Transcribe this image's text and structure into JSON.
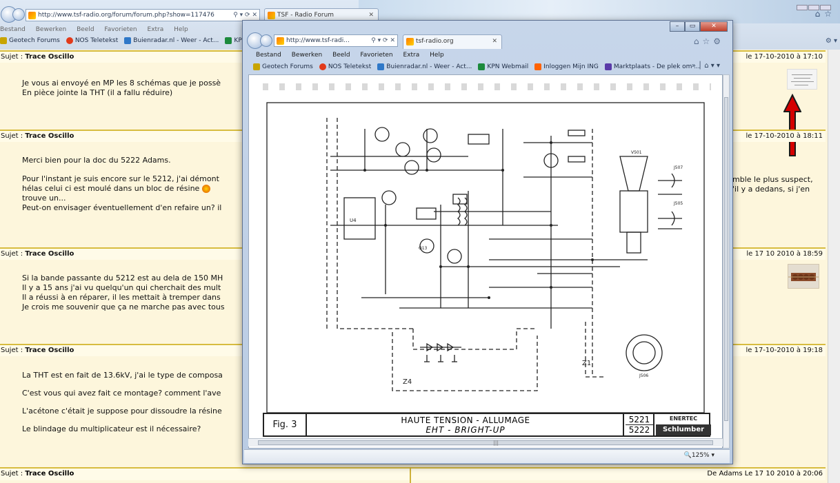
{
  "background_browser": {
    "url": "http://www.tsf-radio.org/forum/forum.php?show=117476",
    "tab_title": "TSF - Radio Forum",
    "menu": [
      "Bestand",
      "Bewerken",
      "Beeld",
      "Favorieten",
      "Extra",
      "Help"
    ],
    "favorites": [
      {
        "label": "Geotech Forums",
        "icon": "geotech-icon",
        "color": "#c8a400"
      },
      {
        "label": "NOS Teletekst",
        "icon": "nos-icon",
        "color": "#e23a1a"
      },
      {
        "label": "Buienradar.nl - Weer - Act...",
        "icon": "buienradar-icon",
        "color": "#2f78c8"
      },
      {
        "label": "KPN Web",
        "icon": "kpn-icon",
        "color": "#1c8a3c"
      }
    ]
  },
  "forum": {
    "posts": [
      {
        "subject_label": "Sujet :",
        "subject": "Trace Oscillo",
        "date": "le 17-10-2010 à 17:10",
        "lines": [
          "Je vous ai envoyé en MP les 8 schémas que je possè",
          "En pièce jointe la THT (il a fallu réduire)"
        ]
      },
      {
        "subject_label": "Sujet :",
        "subject": "Trace Oscillo",
        "date": "le 17-10-2010 à 18:11",
        "lines": [
          "Merci bien pour la doc du 5222 Adams.",
          "Pour l'instant je suis encore sur le 5212, j'ai démont",
          "hélas celui ci est moulé dans un bloc de résine",
          "trouve un...",
          "Peut-on envisager éventuellement d'en refaire un? il"
        ],
        "right_fragments": [
          "mble le plus suspect,",
          "'il y a dedans, si j'en"
        ]
      },
      {
        "subject_label": "Sujet :",
        "subject": "Trace Oscillo",
        "date": "le 17 10 2010 à 18:59",
        "lines": [
          "Si la bande passante du 5212 est au dela de 150 MH",
          "Il y a 15 ans j'ai vu quelqu'un qui cherchait des mult",
          "Il a réussi à en réparer, il les mettait à tremper dans",
          "Je crois me souvenir que ça ne marche pas avec tous"
        ]
      },
      {
        "subject_label": "Sujet :",
        "subject": "Trace Oscillo",
        "date": "le 17-10-2010 à 19:18",
        "lines": [
          "La THT est en fait de 13.6kV, j'ai le type de composa",
          "C'est vous qui avez fait ce montage? comment l'ave",
          "L'acétone c'était je suppose pour dissoudre la résine",
          "Le blindage du multiplicateur est il nécessaire?"
        ]
      }
    ],
    "bottom_post": {
      "subject_label": "Sujet :",
      "subject": "Trace Oscillo",
      "author_date": "De Adams  Le 17 10 2010 à 20:06"
    }
  },
  "popup_browser": {
    "url": "http://www.tsf-radi...",
    "tab_title": "tsf-radio.org",
    "menu": [
      "Bestand",
      "Bewerken",
      "Beeld",
      "Favorieten",
      "Extra",
      "Help"
    ],
    "favorites": [
      {
        "label": "Geotech Forums",
        "icon": "geotech-icon",
        "color": "#c8a400"
      },
      {
        "label": "NOS Teletekst",
        "icon": "nos-icon",
        "color": "#e23a1a"
      },
      {
        "label": "Buienradar.nl - Weer - Act...",
        "icon": "buienradar-icon",
        "color": "#2f78c8"
      },
      {
        "label": "KPN Webmail",
        "icon": "kpn-icon",
        "color": "#1c8a3c"
      },
      {
        "label": "Inloggen Mijn ING",
        "icon": "ing-icon",
        "color": "#ff6200"
      },
      {
        "label": "Marktplaats - De plek om ...",
        "icon": "marktplaats-icon",
        "color": "#5a3aa8"
      }
    ],
    "zoom": "125%",
    "schematic": {
      "fig_label": "Fig. 3",
      "title_line1": "HAUTE TENSION - ALLUMAGE",
      "title_line2": "EHT - BRIGHT-UP",
      "model_1": "5221",
      "model_2": "5222",
      "brand_1": "ENERTEC",
      "brand_2": "Schlumber",
      "zone_z1": "Z1",
      "zone_z4": "Z4",
      "tube_label": "V501",
      "connector_label": "J507",
      "connector_label_2": "J505",
      "socket_label": "J506",
      "component_label": "U4",
      "transistor_label": "Q13"
    }
  }
}
